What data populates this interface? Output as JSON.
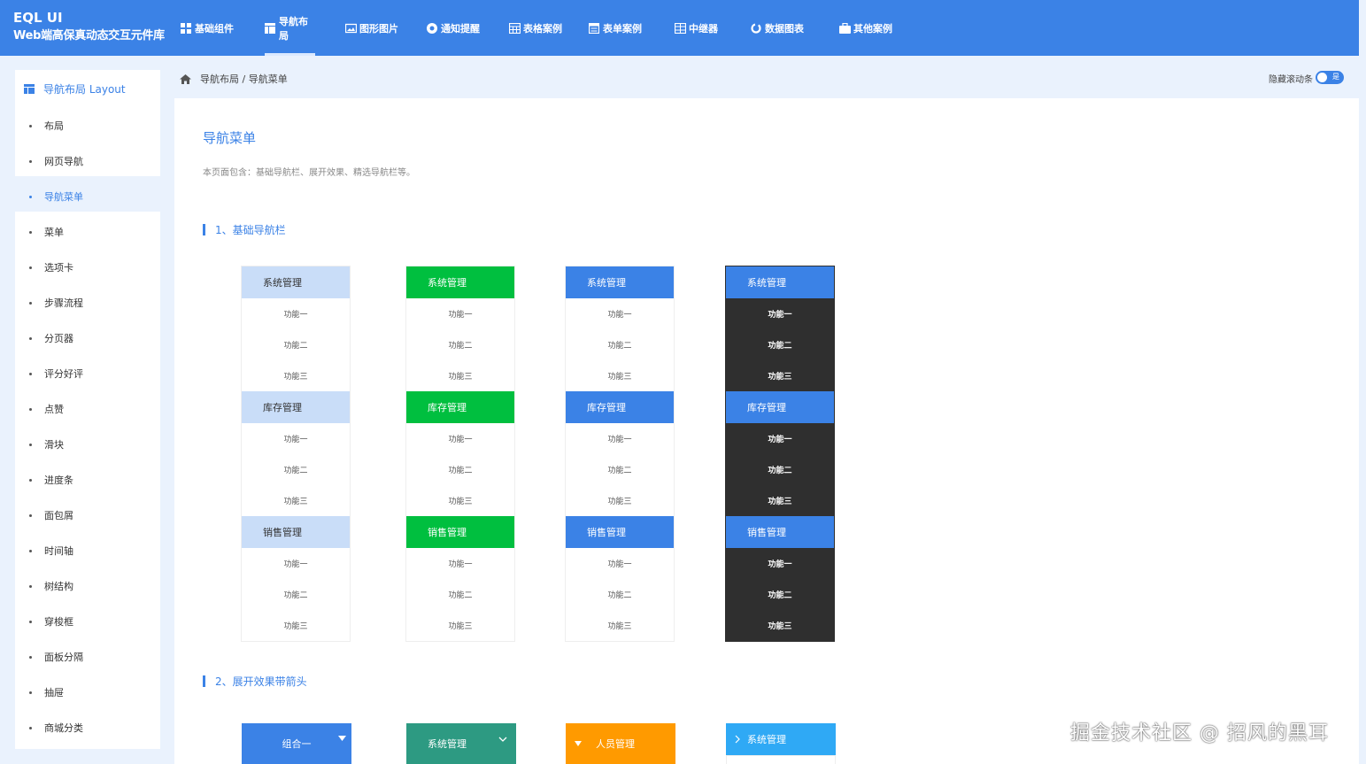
{
  "brand": {
    "title": "EQL UI",
    "subtitle": "Web端高保真动态交互元件库"
  },
  "nav": [
    {
      "label": "基础组件",
      "icon": "grid-icon"
    },
    {
      "label": "导航布局",
      "icon": "layout-icon",
      "active": true
    },
    {
      "label": "图形图片",
      "icon": "image-icon"
    },
    {
      "label": "通知提醒",
      "icon": "notification-icon"
    },
    {
      "label": "表格案例",
      "icon": "table-icon"
    },
    {
      "label": "表单案例",
      "icon": "form-icon"
    },
    {
      "label": "中继器",
      "icon": "repeater-icon"
    },
    {
      "label": "数据图表",
      "icon": "chart-icon"
    },
    {
      "label": "其他案例",
      "icon": "briefcase-icon"
    }
  ],
  "sidebar": {
    "header": "导航布局 Layout",
    "items": [
      "布局",
      "网页导航",
      "导航菜单",
      "菜单",
      "选项卡",
      "步骤流程",
      "分页器",
      "评分好评",
      "点赞",
      "滑块",
      "进度条",
      "面包屑",
      "时间轴",
      "树结构",
      "穿梭框",
      "面板分隔",
      "抽屉",
      "商城分类"
    ],
    "active_index": 2
  },
  "breadcrumb": {
    "parent": "导航布局",
    "separator": " / ",
    "current": "导航菜单"
  },
  "toggle": {
    "label": "隐藏滚动条",
    "state_text": "是"
  },
  "page": {
    "title": "导航菜单",
    "description": "本页面包含：基础导航栏、展开效果、精选导航栏等。"
  },
  "section1": {
    "title": "1、基础导航栏"
  },
  "section2": {
    "title": "2、展开效果带箭头"
  },
  "menu_groups": [
    {
      "title": "系统管理",
      "items": [
        "功能一",
        "功能二",
        "功能三"
      ]
    },
    {
      "title": "库存管理",
      "items": [
        "功能一",
        "功能二",
        "功能三"
      ]
    },
    {
      "title": "销售管理",
      "items": [
        "功能一",
        "功能二",
        "功能三"
      ]
    }
  ],
  "expand_headers": [
    {
      "label": "组合一",
      "color": "#3b82e6"
    },
    {
      "label": "系统管理",
      "color": "#2d9a82"
    },
    {
      "label": "人员管理",
      "color": "#ff9a00"
    },
    {
      "label": "系统管理",
      "color": "#2fa9f5"
    }
  ],
  "watermark": "掘金技术社区 @ 招风的黑耳",
  "colors": {
    "primary": "#3b82e6",
    "green": "#00bf3f",
    "dark": "#2f2f2f",
    "light_blue": "#c9ddf8"
  }
}
